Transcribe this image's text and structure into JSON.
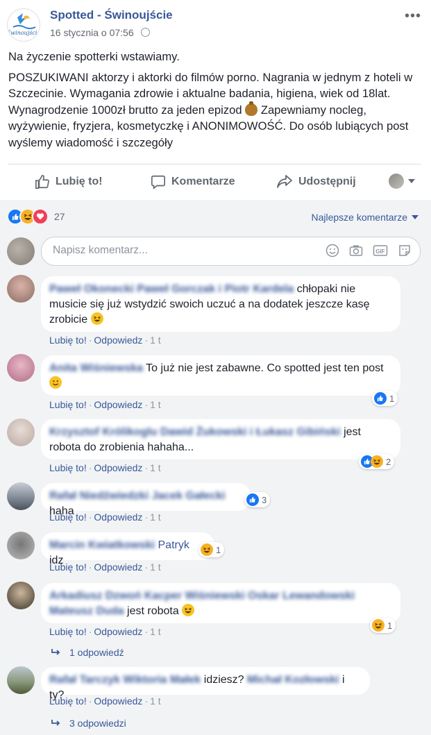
{
  "post": {
    "page_name": "Spotted - Świnoujście",
    "timestamp": "16 stycznia o 07:56",
    "paragraph1": "Na życzenie spotterki wstawiamy.",
    "paragraph2_before_emoji": "POSZUKIWANI aktorzy i aktorki do filmów porno. Nagrania w jednym z hoteli w Szczecinie. Wymagania zdrowie i aktualne badania, higiena, wiek od 18lat. Wynagrodzenie 1000zł brutto za jeden epizod",
    "paragraph2_after_emoji": "Zapewniamy nocleg, wyżywienie, fryzjera, kosmetyczkę i ANONIMOWOŚĆ. Do osób lubiących post wyślemy wiadomość i szczegóły",
    "logo_text": "Świnoujście"
  },
  "actions": {
    "like": "Lubię to!",
    "comment": "Komentarze",
    "share": "Udostępnij"
  },
  "reactions": {
    "count": "27",
    "types": [
      "like",
      "haha",
      "love"
    ]
  },
  "sort_label": "Najlepsze komentarze",
  "composer": {
    "placeholder": "Napisz komentarz...",
    "icons": [
      "emoji-icon",
      "camera-icon",
      "gif-icon",
      "sticker-icon"
    ]
  },
  "comment_actions": {
    "like": "Lubię to!",
    "reply": "Odpowiedz",
    "dot": "·"
  },
  "comments": [
    {
      "author": "Paweł Okonecki Paweł Gorczak i Piotr Kardela",
      "text": "chłopaki nie musicie się już wstydzić swoich uczuć a na dodatek jeszcze kasę zrobicie",
      "emoji": "laugh-emoji",
      "time": "1 t",
      "reactions": null
    },
    {
      "author": "Anita Wiśniewska",
      "text": "To już nie jest zabawne. Co spotted jest ten post",
      "emoji": "smile-emoji",
      "time": "1 t",
      "reactions": {
        "types": [
          "like"
        ],
        "count": "1"
      }
    },
    {
      "author": "Krzysztof Królikoglu Dawid Żukowski i Łukasz Gibiński",
      "text": "jest robota do zrobienia hahaha...",
      "time": "1 t",
      "reactions": {
        "types": [
          "like",
          "haha"
        ],
        "count": "2"
      }
    },
    {
      "author": "Rafał Niedźwiedzki Jacek Gałecki",
      "text": "haha",
      "time": "1 t",
      "reactions": {
        "types": [
          "like"
        ],
        "count": "3"
      }
    },
    {
      "author": "Marcin Kwiatkowski",
      "tagged": "Patryk",
      "text": "idz",
      "time": "1 t",
      "reactions": {
        "types": [
          "haha"
        ],
        "count": "1"
      }
    },
    {
      "author": "Arkadiusz Dzwoń Kacper Wiśniewski Oskar Lewandowski Mateusz Duda",
      "text": "jest robota",
      "emoji": "laugh-emoji",
      "time": "1 t",
      "reactions": {
        "types": [
          "haha"
        ],
        "count": "1"
      },
      "replies": "1 odpowiedź"
    },
    {
      "author": "Rafał Tarczyk Wiktoria Małek",
      "text": "idziesz?",
      "author2": "Michał Kozłowski",
      "text2": "i ty?",
      "time": "1 t",
      "reactions": null,
      "replies": "3 odpowiedzi"
    }
  ],
  "colors": {
    "link": "#385898",
    "like": "#1877f2",
    "haha": "#f7b125",
    "love": "#f33e58",
    "background": "#f2f3f5"
  }
}
